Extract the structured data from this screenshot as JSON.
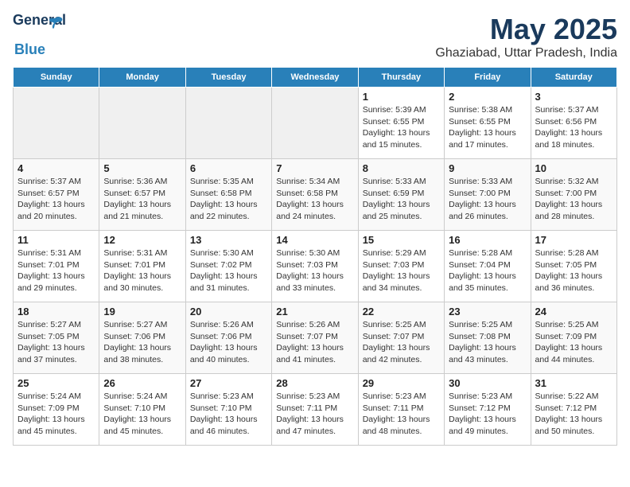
{
  "logo": {
    "name_general": "General",
    "name_blue": "Blue",
    "tagline": ""
  },
  "title": "May 2025",
  "subtitle": "Ghaziabad, Uttar Pradesh, India",
  "headers": [
    "Sunday",
    "Monday",
    "Tuesday",
    "Wednesday",
    "Thursday",
    "Friday",
    "Saturday"
  ],
  "weeks": [
    [
      {
        "day": "",
        "text": "",
        "empty": true
      },
      {
        "day": "",
        "text": "",
        "empty": true
      },
      {
        "day": "",
        "text": "",
        "empty": true
      },
      {
        "day": "",
        "text": "",
        "empty": true
      },
      {
        "day": "1",
        "text": "Sunrise: 5:39 AM\nSunset: 6:55 PM\nDaylight: 13 hours and 15 minutes.",
        "empty": false
      },
      {
        "day": "2",
        "text": "Sunrise: 5:38 AM\nSunset: 6:55 PM\nDaylight: 13 hours and 17 minutes.",
        "empty": false
      },
      {
        "day": "3",
        "text": "Sunrise: 5:37 AM\nSunset: 6:56 PM\nDaylight: 13 hours and 18 minutes.",
        "empty": false
      }
    ],
    [
      {
        "day": "4",
        "text": "Sunrise: 5:37 AM\nSunset: 6:57 PM\nDaylight: 13 hours and 20 minutes.",
        "empty": false
      },
      {
        "day": "5",
        "text": "Sunrise: 5:36 AM\nSunset: 6:57 PM\nDaylight: 13 hours and 21 minutes.",
        "empty": false
      },
      {
        "day": "6",
        "text": "Sunrise: 5:35 AM\nSunset: 6:58 PM\nDaylight: 13 hours and 22 minutes.",
        "empty": false
      },
      {
        "day": "7",
        "text": "Sunrise: 5:34 AM\nSunset: 6:58 PM\nDaylight: 13 hours and 24 minutes.",
        "empty": false
      },
      {
        "day": "8",
        "text": "Sunrise: 5:33 AM\nSunset: 6:59 PM\nDaylight: 13 hours and 25 minutes.",
        "empty": false
      },
      {
        "day": "9",
        "text": "Sunrise: 5:33 AM\nSunset: 7:00 PM\nDaylight: 13 hours and 26 minutes.",
        "empty": false
      },
      {
        "day": "10",
        "text": "Sunrise: 5:32 AM\nSunset: 7:00 PM\nDaylight: 13 hours and 28 minutes.",
        "empty": false
      }
    ],
    [
      {
        "day": "11",
        "text": "Sunrise: 5:31 AM\nSunset: 7:01 PM\nDaylight: 13 hours and 29 minutes.",
        "empty": false
      },
      {
        "day": "12",
        "text": "Sunrise: 5:31 AM\nSunset: 7:01 PM\nDaylight: 13 hours and 30 minutes.",
        "empty": false
      },
      {
        "day": "13",
        "text": "Sunrise: 5:30 AM\nSunset: 7:02 PM\nDaylight: 13 hours and 31 minutes.",
        "empty": false
      },
      {
        "day": "14",
        "text": "Sunrise: 5:30 AM\nSunset: 7:03 PM\nDaylight: 13 hours and 33 minutes.",
        "empty": false
      },
      {
        "day": "15",
        "text": "Sunrise: 5:29 AM\nSunset: 7:03 PM\nDaylight: 13 hours and 34 minutes.",
        "empty": false
      },
      {
        "day": "16",
        "text": "Sunrise: 5:28 AM\nSunset: 7:04 PM\nDaylight: 13 hours and 35 minutes.",
        "empty": false
      },
      {
        "day": "17",
        "text": "Sunrise: 5:28 AM\nSunset: 7:05 PM\nDaylight: 13 hours and 36 minutes.",
        "empty": false
      }
    ],
    [
      {
        "day": "18",
        "text": "Sunrise: 5:27 AM\nSunset: 7:05 PM\nDaylight: 13 hours and 37 minutes.",
        "empty": false
      },
      {
        "day": "19",
        "text": "Sunrise: 5:27 AM\nSunset: 7:06 PM\nDaylight: 13 hours and 38 minutes.",
        "empty": false
      },
      {
        "day": "20",
        "text": "Sunrise: 5:26 AM\nSunset: 7:06 PM\nDaylight: 13 hours and 40 minutes.",
        "empty": false
      },
      {
        "day": "21",
        "text": "Sunrise: 5:26 AM\nSunset: 7:07 PM\nDaylight: 13 hours and 41 minutes.",
        "empty": false
      },
      {
        "day": "22",
        "text": "Sunrise: 5:25 AM\nSunset: 7:07 PM\nDaylight: 13 hours and 42 minutes.",
        "empty": false
      },
      {
        "day": "23",
        "text": "Sunrise: 5:25 AM\nSunset: 7:08 PM\nDaylight: 13 hours and 43 minutes.",
        "empty": false
      },
      {
        "day": "24",
        "text": "Sunrise: 5:25 AM\nSunset: 7:09 PM\nDaylight: 13 hours and 44 minutes.",
        "empty": false
      }
    ],
    [
      {
        "day": "25",
        "text": "Sunrise: 5:24 AM\nSunset: 7:09 PM\nDaylight: 13 hours and 45 minutes.",
        "empty": false
      },
      {
        "day": "26",
        "text": "Sunrise: 5:24 AM\nSunset: 7:10 PM\nDaylight: 13 hours and 45 minutes.",
        "empty": false
      },
      {
        "day": "27",
        "text": "Sunrise: 5:23 AM\nSunset: 7:10 PM\nDaylight: 13 hours and 46 minutes.",
        "empty": false
      },
      {
        "day": "28",
        "text": "Sunrise: 5:23 AM\nSunset: 7:11 PM\nDaylight: 13 hours and 47 minutes.",
        "empty": false
      },
      {
        "day": "29",
        "text": "Sunrise: 5:23 AM\nSunset: 7:11 PM\nDaylight: 13 hours and 48 minutes.",
        "empty": false
      },
      {
        "day": "30",
        "text": "Sunrise: 5:23 AM\nSunset: 7:12 PM\nDaylight: 13 hours and 49 minutes.",
        "empty": false
      },
      {
        "day": "31",
        "text": "Sunrise: 5:22 AM\nSunset: 7:12 PM\nDaylight: 13 hours and 50 minutes.",
        "empty": false
      }
    ]
  ]
}
